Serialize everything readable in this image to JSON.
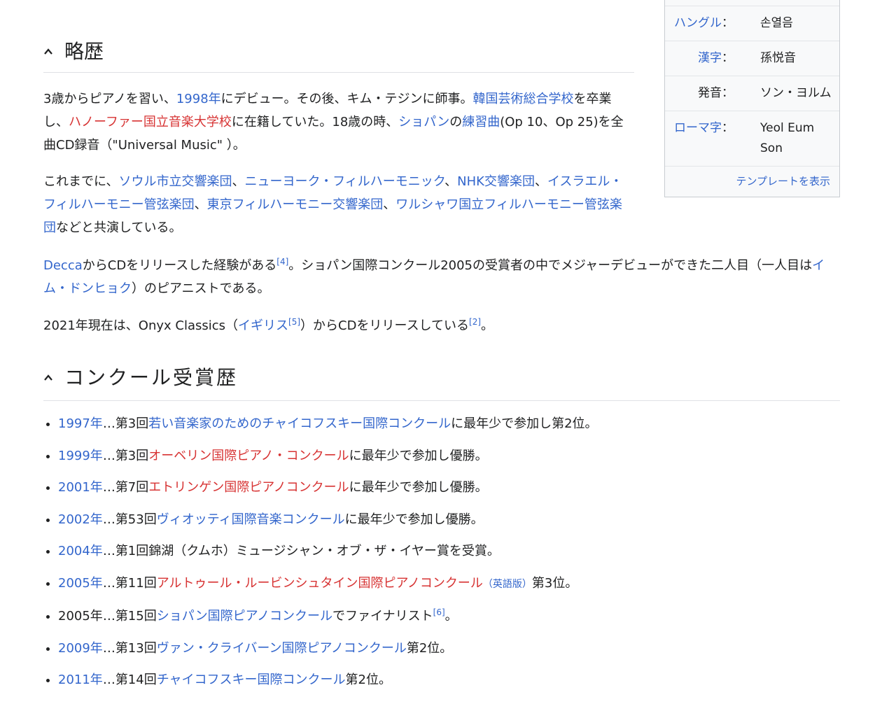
{
  "infobox": {
    "rows": [
      {
        "label": "ハングル",
        "label_link": true,
        "value": "손열음"
      },
      {
        "label": "漢字",
        "label_link": true,
        "value": "孫悦音"
      },
      {
        "label": "発音",
        "label_link": false,
        "value": "ソン・ヨルム"
      },
      {
        "label": "ローマ字",
        "label_link": true,
        "value": "Yeol Eum Son"
      }
    ],
    "colon": "：",
    "footer_link": "テンプレートを表示"
  },
  "section1": {
    "title": "略歴",
    "p1": {
      "t1": "3歳からピアノを習い、",
      "l1": "1998年",
      "t2": "にデビュー。その後、キム・テジンに師事。",
      "l2": "韓国芸術総合学校",
      "t3": "を卒業し、",
      "l3": "ハノーファー国立音楽大学校",
      "t4": "に在籍していた。18歳の時、",
      "l4": "ショパン",
      "t5": "の",
      "l5": "練習曲",
      "t6": "(Op 10、Op 25)を全曲CD録音（\"Universal Music\" ）。"
    },
    "p2": {
      "t1": "これまでに、",
      "l1": "ソウル市立交響楽団",
      "s1": "、",
      "l2": "ニューヨーク・フィルハーモニック",
      "s2": "、",
      "l3": "NHK交響楽団",
      "s3": "、",
      "l4": "イスラエル・フィルハーモニー管弦楽団",
      "s4": "、",
      "l5": "東京フィルハーモニー交響楽団",
      "s5": "、",
      "l6": "ワルシャワ国立フィルハーモニー管弦楽団",
      "t2": "などと共演している。"
    },
    "p3": {
      "l1": "Decca",
      "t1": "からCDをリリースした経験がある",
      "ref1": "[4]",
      "t2": "。ショパン国際コンクール2005の受賞者の中でメジャーデビューができた二人目（一人目は",
      "l2": "イム・ドンヒョク",
      "t3": "）のピアニストである。"
    },
    "p4": {
      "t1": "2021年現在は、Onyx Classics（",
      "l1": "イギリス",
      "ref1": "[5]",
      "t2": "）からCDをリリースしている",
      "ref2": "[2]",
      "t3": "。"
    }
  },
  "section2": {
    "title": "コンクール受賞歴",
    "items": [
      {
        "year": "1997年",
        "year_link": true,
        "pre": "…第3回",
        "comp": "若い音楽家のためのチャイコフスキー国際コンクール",
        "comp_color": "blue",
        "post": "に最年少で参加し第2位。"
      },
      {
        "year": "1999年",
        "year_link": true,
        "pre": "…第3回",
        "comp": "オーベリン国際ピアノ・コンクール",
        "comp_color": "red",
        "post": "に最年少で参加し優勝。"
      },
      {
        "year": "2001年",
        "year_link": true,
        "pre": "…第7回",
        "comp": "エトリンゲン国際ピアノコンクール",
        "comp_color": "red",
        "post": "に最年少で参加し優勝。"
      },
      {
        "year": "2002年",
        "year_link": true,
        "pre": "…第53回",
        "comp": "ヴィオッティ国際音楽コンクール",
        "comp_color": "blue",
        "post": "に最年少で参加し優勝。"
      },
      {
        "year": "2004年",
        "year_link": true,
        "pre": "…第1回錦湖（クムホ）ミュージシャン・オブ・ザ・イヤー賞を受賞。",
        "comp": "",
        "comp_color": "blue",
        "post": ""
      },
      {
        "year": "2005年",
        "year_link": true,
        "pre": "…第11回",
        "comp": "アルトゥール・ルービンシュタイン国際ピアノコンクール",
        "comp_color": "red",
        "extra": "（英語版）",
        "post": "第3位。"
      },
      {
        "year": "2005年",
        "year_link": false,
        "pre": "…第15回",
        "comp": "ショパン国際ピアノコンクール",
        "comp_color": "blue",
        "post": "でファイナリスト",
        "ref": "[6]",
        "post2": "。"
      },
      {
        "year": "2009年",
        "year_link": true,
        "pre": "…第13回",
        "comp": "ヴァン・クライバーン国際ピアノコンクール",
        "comp_color": "blue",
        "post": "第2位。"
      },
      {
        "year": "2011年",
        "year_link": true,
        "pre": "…第14回",
        "comp": "チャイコフスキー国際コンクール",
        "comp_color": "blue",
        "post": "第2位。"
      }
    ]
  }
}
